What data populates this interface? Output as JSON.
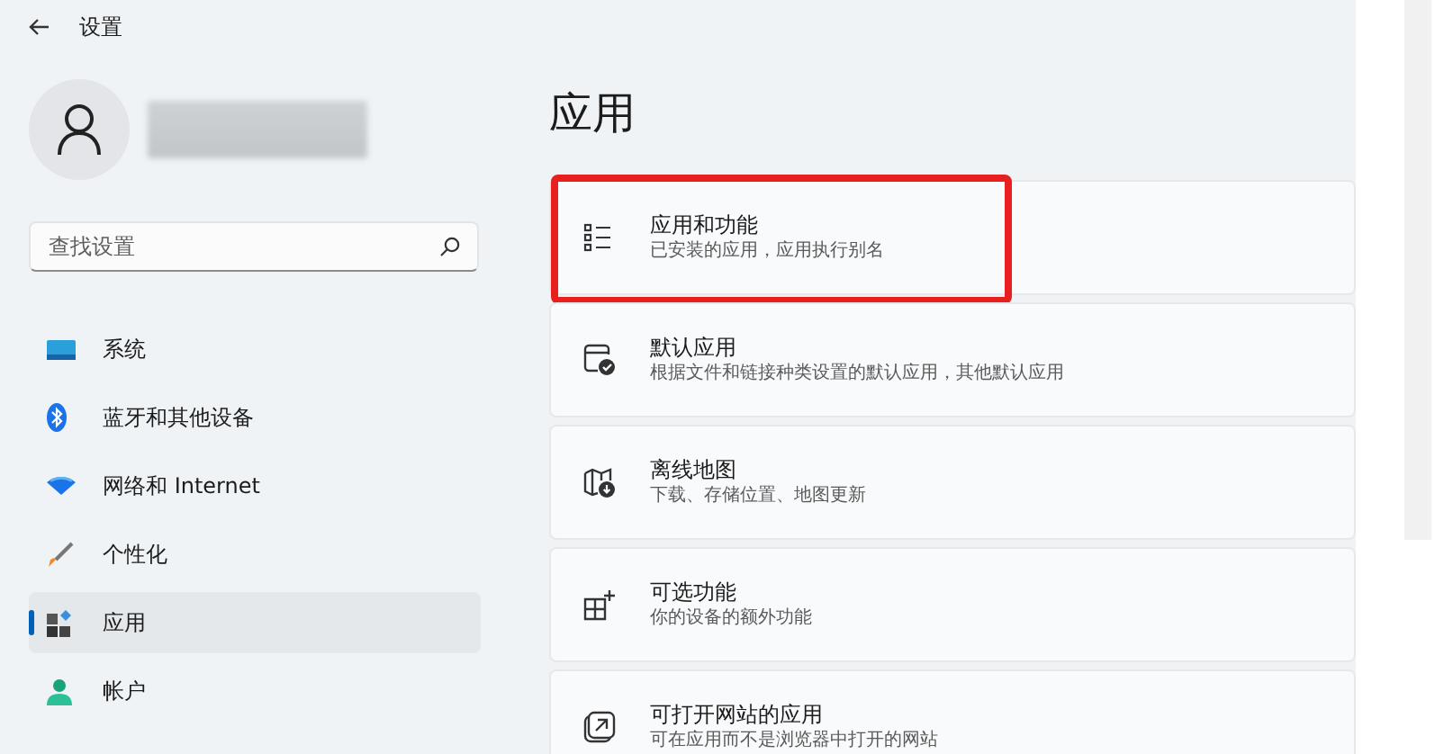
{
  "window": {
    "title": "设置"
  },
  "search": {
    "placeholder": "查找设置"
  },
  "sidebar": {
    "items": [
      {
        "label": "系统",
        "selected": false
      },
      {
        "label": "蓝牙和其他设备",
        "selected": false
      },
      {
        "label": "网络和 Internet",
        "selected": false
      },
      {
        "label": "个性化",
        "selected": false
      },
      {
        "label": "应用",
        "selected": true
      },
      {
        "label": "帐户",
        "selected": false
      }
    ]
  },
  "page": {
    "title": "应用",
    "cards": [
      {
        "title": "应用和功能",
        "subtitle": "已安装的应用，应用执行别名",
        "highlighted": true
      },
      {
        "title": "默认应用",
        "subtitle": "根据文件和链接种类设置的默认应用，其他默认应用",
        "highlighted": false
      },
      {
        "title": "离线地图",
        "subtitle": "下载、存储位置、地图更新",
        "highlighted": false
      },
      {
        "title": "可选功能",
        "subtitle": "你的设备的额外功能",
        "highlighted": false
      },
      {
        "title": "可打开网站的应用",
        "subtitle": "可在应用而不是浏览器中打开的网站",
        "highlighted": false
      }
    ]
  }
}
